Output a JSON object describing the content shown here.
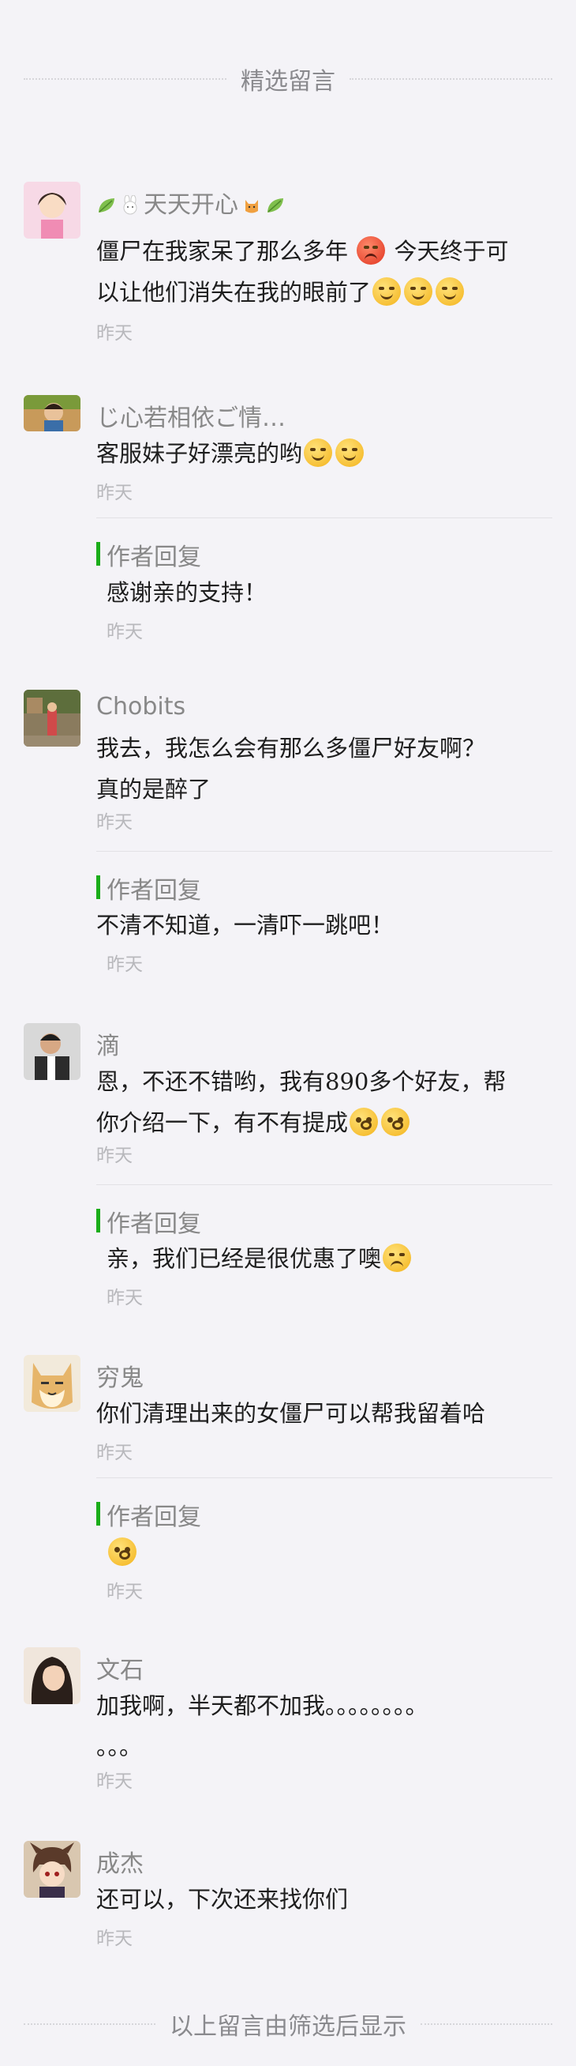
{
  "header": {
    "title": "精选留言"
  },
  "footer": {
    "text": "以上留言由筛选后显示"
  },
  "comments": [
    {
      "nickname": "天天开心",
      "text_line1": "僵尸在我家呆了那么多年",
      "text_line1b": "今天终于可",
      "text_line2": "以让他们消失在我的眼前了",
      "time": "昨天"
    },
    {
      "nickname": "じ心若相依ご情…",
      "text": "客服妹子好漂亮的哟",
      "time": "昨天",
      "reply": {
        "label": "作者回复",
        "text": "感谢亲的支持！",
        "time": "昨天"
      }
    },
    {
      "nickname": "Chobits",
      "text_line1": "我去，我怎么会有那么多僵尸好友啊？",
      "text_line2": "真的是醉了",
      "time": "昨天",
      "reply": {
        "label": "作者回复",
        "text": "不清不知道，一清吓一跳吧！",
        "time": "昨天"
      }
    },
    {
      "nickname": "滴",
      "text_line1": "恩，不还不错哟，我有890多个好友，帮",
      "text_line2": "你介绍一下，有不有提成",
      "time": "昨天",
      "reply": {
        "label": "作者回复",
        "text": "亲，我们已经是很优惠了噢",
        "time": "昨天"
      }
    },
    {
      "nickname": "穷鬼",
      "text": "你们清理出来的女僵尸可以帮我留着哈",
      "time": "昨天",
      "reply": {
        "label": "作者回复",
        "text": "",
        "time": "昨天"
      }
    },
    {
      "nickname": "文石",
      "text_line1": "加我啊，半天都不加我。。。。。。。。",
      "text_line2": "。。。",
      "time": "昨天"
    },
    {
      "nickname": "成杰",
      "text": "还可以，下次还来找你们",
      "time": "昨天"
    }
  ],
  "colors": {
    "reply_bar": "#1aad19",
    "background": "#f4f3f7"
  }
}
